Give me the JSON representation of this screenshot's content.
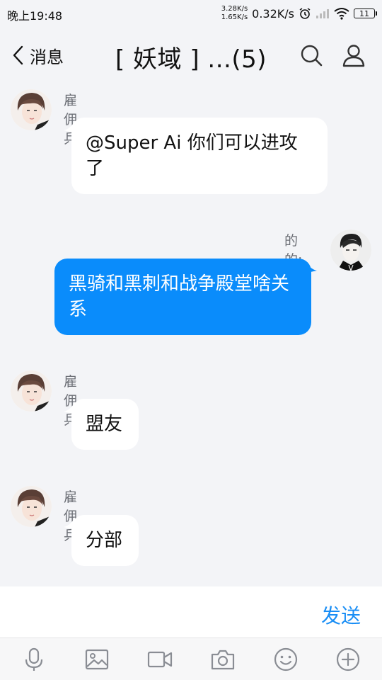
{
  "status_bar": {
    "time": "晚上19:48",
    "upload_speed": "3.28K/s",
    "download_speed": "1.65K/s",
    "net_speed": "0.32K/s",
    "battery": "11",
    "icons": [
      "alarm-icon",
      "signal-icon",
      "wifi-icon",
      "battery-icon"
    ]
  },
  "header": {
    "back_label": "消息",
    "title": "[ 妖域 ] ...(5)",
    "icons": [
      "search-icon",
      "profile-icon"
    ]
  },
  "messages": [
    {
      "direction": "incoming",
      "sender": "雇佣兵:",
      "text": "@Super Ai 你们可以进攻了"
    },
    {
      "direction": "outgoing",
      "sender": "的的:",
      "text": "黑骑和黑刺和战争殿堂啥关系"
    },
    {
      "direction": "incoming",
      "sender": "雇佣兵:",
      "text": "盟友"
    },
    {
      "direction": "incoming",
      "sender": "雇佣兵:",
      "text": "分部"
    }
  ],
  "input": {
    "send_label": "发送"
  },
  "toolbar": {
    "items": [
      "microphone-icon",
      "image-icon",
      "video-icon",
      "camera-icon",
      "emoji-icon",
      "plus-icon"
    ]
  },
  "colors": {
    "accent": "#1a8ef5",
    "outgoing_bubble": "#0a8cfb",
    "background": "#f3f4f7"
  }
}
